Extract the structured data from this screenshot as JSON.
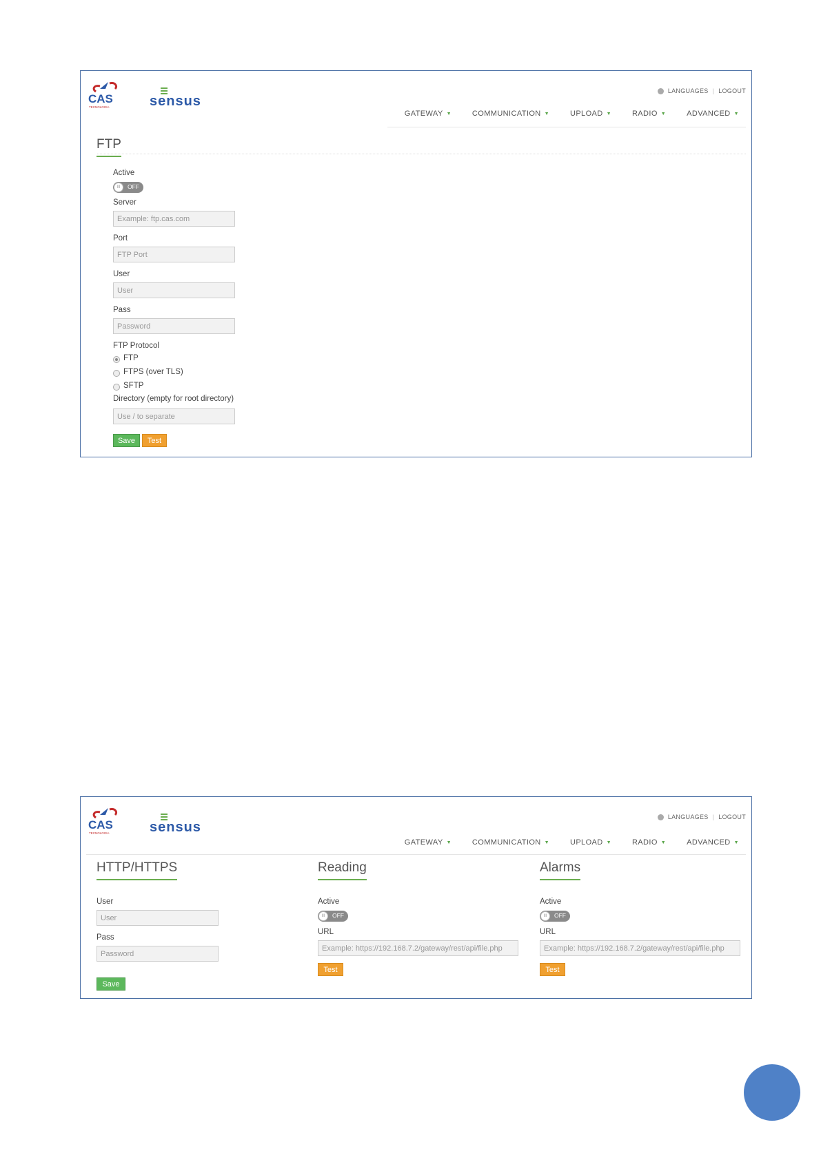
{
  "ftp_screen": {
    "top": {
      "languages": "LANGUAGES",
      "separator": "|",
      "logout": "LOGOUT"
    },
    "nav": [
      "GATEWAY",
      "COMMUNICATION",
      "UPLOAD",
      "RADIO",
      "ADVANCED"
    ],
    "title": "FTP",
    "active_label": "Active",
    "toggle_text": "OFF",
    "server_label": "Server",
    "server_placeholder": "Example: ftp.cas.com",
    "port_label": "Port",
    "port_placeholder": "FTP Port",
    "user_label": "User",
    "user_placeholder": "User",
    "pass_label": "Pass",
    "pass_placeholder": "Password",
    "protocol_label": "FTP Protocol",
    "protocols": [
      "FTP",
      "FTPS (over TLS)",
      "SFTP"
    ],
    "selected_protocol": "FTP",
    "directory_label": "Directory (empty for root directory)",
    "directory_placeholder": "Use / to separate",
    "save": "Save",
    "test": "Test"
  },
  "http_screen": {
    "top": {
      "languages": "LANGUAGES",
      "separator": "|",
      "logout": "LOGOUT"
    },
    "nav": [
      "GATEWAY",
      "COMMUNICATION",
      "UPLOAD",
      "RADIO",
      "ADVANCED"
    ],
    "http": {
      "title": "HTTP/HTTPS",
      "user_label": "User",
      "user_placeholder": "User",
      "pass_label": "Pass",
      "pass_placeholder": "Password",
      "save": "Save"
    },
    "reading": {
      "title": "Reading",
      "active_label": "Active",
      "toggle_text": "OFF",
      "url_label": "URL",
      "url_placeholder": "Example: https://192.168.7.2/gateway/rest/api/file.php",
      "test": "Test"
    },
    "alarms": {
      "title": "Alarms",
      "active_label": "Active",
      "toggle_text": "OFF",
      "url_label": "URL",
      "url_placeholder": "Example: https://192.168.7.2/gateway/rest/api/file.php",
      "test": "Test"
    }
  },
  "colors": {
    "accent_green": "#5cb85c",
    "accent_orange": "#f0a030",
    "frame_blue": "#4a6fa5",
    "page_circle": "#4f81c7"
  }
}
